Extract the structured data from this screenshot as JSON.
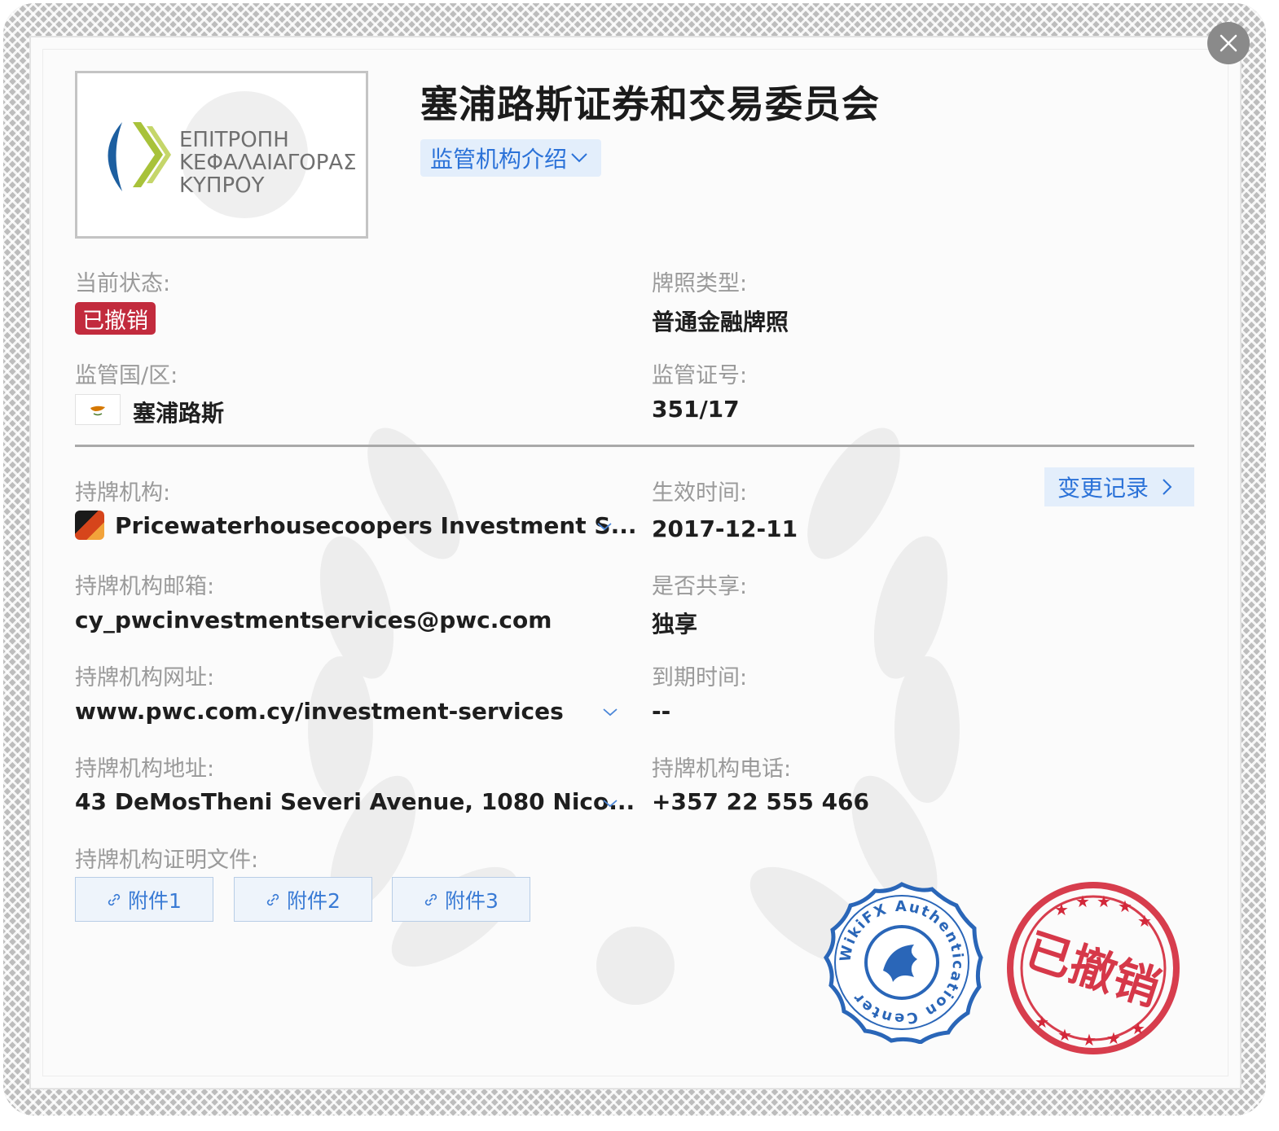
{
  "header": {
    "title": "塞浦路斯证券和交易委员会",
    "intro_button": "监管机构介绍"
  },
  "logo": {
    "lines": [
      "ΕΠΙΤΡΟΠΗ",
      "ΚΕΦΑΛΑΙΑΓΟΡΑΣ",
      "ΚΥΠΡΟΥ"
    ],
    "colors": {
      "blue": "#1d5fa0",
      "green": "#a8c23a",
      "text": "#6f6f6f"
    }
  },
  "fields": {
    "status_label": "当前状态:",
    "status_value": "已撤销",
    "license_type_label": "牌照类型:",
    "license_type_value": "普通金融牌照",
    "region_label": "监管国/区:",
    "region_value": "塞浦路斯",
    "license_no_label": "监管证号:",
    "license_no_value": "351/17",
    "holder_label": "持牌机构:",
    "holder_value": "Pricewaterhousecoopers Investment S...",
    "effective_label": "生效时间:",
    "effective_value": "2017-12-11",
    "history_button": "变更记录",
    "email_label": "持牌机构邮箱:",
    "email_value": "cy_pwcinvestmentservices@pwc.com",
    "shared_label": "是否共享:",
    "shared_value": "独享",
    "website_label": "持牌机构网址:",
    "website_value": "www.pwc.com.cy/investment-services",
    "expiry_label": "到期时间:",
    "expiry_value": "--",
    "address_label": "持牌机构地址:",
    "address_value": "43 DeMosTheni Severi Avenue, 1080 Nico...",
    "phone_label": "持牌机构电话:",
    "phone_value": "+357 22 555 466",
    "docs_label": "持牌机构证明文件:"
  },
  "attachments": [
    "附件1",
    "附件2",
    "附件3"
  ],
  "seals": {
    "wikifx_text": "WikiFX Authentication Center",
    "revoked_text": "已撤销"
  },
  "colors": {
    "accent": "#2b72d8",
    "badge_red": "#c22b3d",
    "seal_blue": "#2a66b8",
    "stamp_red": "#d3283a"
  },
  "icons": [
    "close-icon",
    "chevron-down-icon",
    "chevron-right-icon",
    "link-icon",
    "cyprus-flag-icon",
    "company-logo-icon"
  ]
}
